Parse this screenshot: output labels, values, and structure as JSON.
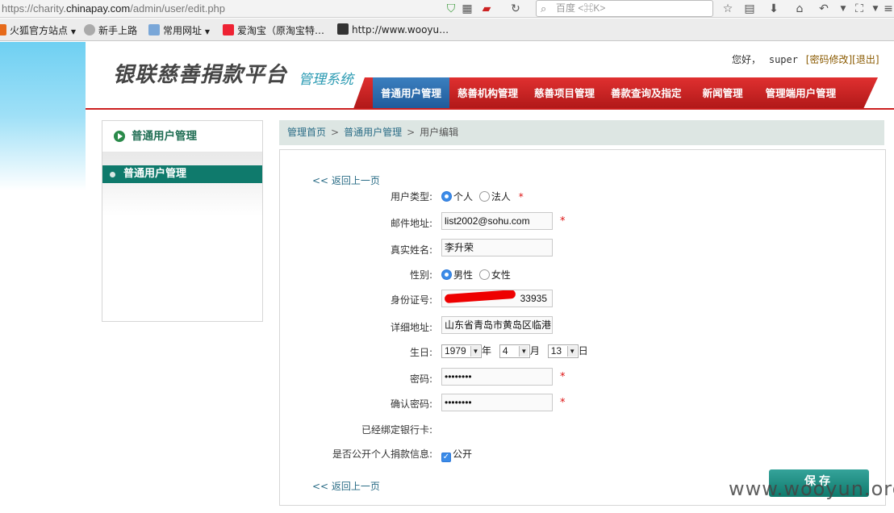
{
  "browser": {
    "url_prefix": "https://charity.",
    "url_domain": "chinapay.com",
    "url_suffix": "/admin/user/edit.php",
    "search_placeholder": "百度 <⌘K>",
    "bookmarks": [
      "火狐官方站点",
      "新手上路",
      "常用网址",
      "爱淘宝（原淘宝特…",
      "http://www.wooyu…"
    ]
  },
  "header": {
    "logo": "银联慈善捐款平台",
    "logo_sub": "管理系统",
    "greeting": "您好，",
    "username": "super",
    "change_password": "[密码修改]",
    "logout": "[退出]",
    "nav": [
      "普通用户管理",
      "慈善机构管理",
      "慈善项目管理",
      "善款查询及指定",
      "新闻管理",
      "管理端用户管理"
    ]
  },
  "sidebar": {
    "title": "普通用户管理",
    "items": [
      "普通用户管理"
    ]
  },
  "breadcrumb": [
    "管理首页",
    "普通用户管理",
    "用户编辑"
  ],
  "form": {
    "back_link": "<< 返回上一页",
    "user_type_label": "用户类型:",
    "user_type_options": [
      "个人",
      "法人"
    ],
    "user_type_selected": "个人",
    "email_label": "邮件地址:",
    "email_value": "list2002@sohu.com",
    "realname_label": "真实姓名:",
    "realname_value": "李升荣",
    "gender_label": "性别:",
    "gender_options": [
      "男性",
      "女性"
    ],
    "gender_selected": "男性",
    "idcard_label": "身份证号:",
    "idcard_visible": "33935",
    "address_label": "详细地址:",
    "address_value": "山东省青岛市黄岛区临港",
    "birthday_label": "生日:",
    "birth_year": "1979",
    "birth_year_unit": "年",
    "birth_month": "4",
    "birth_month_unit": "月",
    "birth_day": "13",
    "birth_day_unit": "日",
    "password_label": "密码:",
    "password_value": "••••••••",
    "confirm_label": "确认密码:",
    "confirm_value": "••••••••",
    "bankcard_label": "已经绑定银行卡:",
    "public_label": "是否公开个人捐款信息:",
    "public_option": "公开",
    "public_checked": true,
    "required_mark": "*",
    "save_label": "保存"
  },
  "watermark": "www.wooyun.org",
  "colors": {
    "nav_red": "#cc1f1f",
    "nav_active": "#2a6aa8",
    "sidebar_green": "#0f7a6c",
    "link": "#2a6c86"
  }
}
